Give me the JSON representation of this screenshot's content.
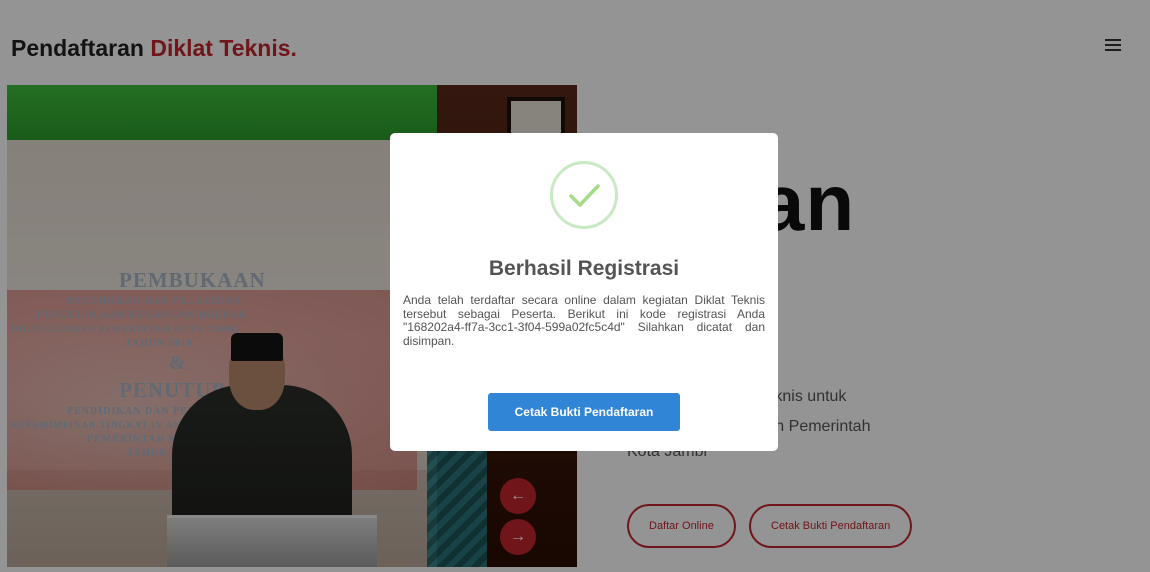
{
  "header": {
    "brand_main": "Pendaftaran",
    "brand_accent": "Diklat Teknis."
  },
  "hero": {
    "banner_lines": [
      "PEMBUKAAN",
      "PENDIDIKAN DAN PELATIHAN",
      "PENGELOLAAN KEUANGAN DAERAH",
      "DILINGKUNGAN PEMERINTAH KOTA JAMBI",
      "TAHUN 2018",
      "&",
      "PENUTUPAN",
      "PENDIDIKAN DAN PELATIHAN",
      "KEPEMIMPINAN TINGKAT IV ANGKATAN XIV",
      "PEMERINTAH KOTA JAMBI",
      "TAHUN"
    ],
    "title_visible": "ftaran",
    "desc_line1": "nline diklat teknis untuk",
    "desc_line2": "a dilingkungan Pemerintah",
    "desc_line3": "Kota Jambi",
    "btn_daftar": "Daftar Online",
    "btn_cetak": "Cetak Bukti Pendaftaran",
    "prev_icon": "arrow-left-icon",
    "next_icon": "arrow-right-icon"
  },
  "modal": {
    "title": "Berhasil Registrasi",
    "text": "Anda telah terdaftar secara online dalam kegiatan Diklat Teknis tersebut sebagai Peserta. Berikut ini kode registrasi Anda \"168202a4-ff7a-3cc1-3f04-599a02fc5c4d\" Silahkan dicatat dan disimpan.",
    "button": "Cetak Bukti Pendaftaran",
    "icon": "check-icon"
  },
  "colors": {
    "accent": "#c1272d",
    "modal_button": "#3085d6",
    "success": "#a5dc86"
  }
}
